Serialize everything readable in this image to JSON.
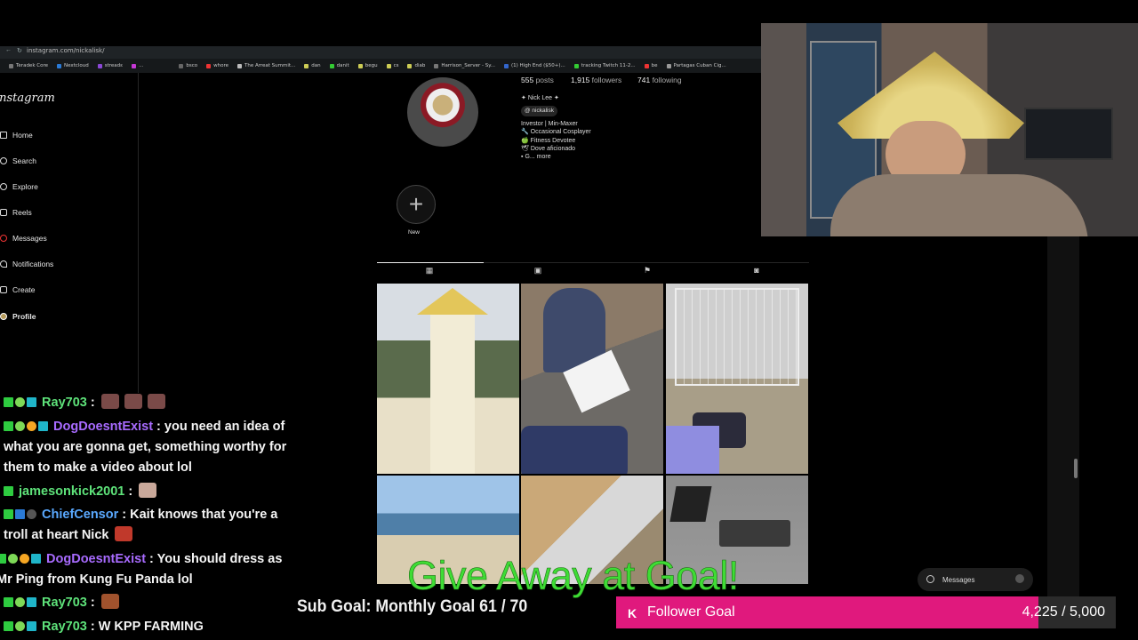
{
  "browser": {
    "url": "instagram.com/nickalisk/",
    "bookmarks": [
      "Teradek Core",
      "Nextcloud",
      "streadε",
      "...",
      "bsco",
      "whore",
      "The Arreat Summit...",
      "dan",
      "danit",
      "begu",
      "cs",
      "diab",
      "Harrison_Server - Sy...",
      "(1) High End ($50+)...",
      "tracking Twitch 11-2...",
      "be",
      "Partagas Cuban Cig..."
    ]
  },
  "instagram": {
    "logo": "Instagram",
    "nav": [
      "Home",
      "Search",
      "Explore",
      "Reels",
      "Messages",
      "Notifications",
      "Create",
      "Profile"
    ],
    "stats": {
      "posts": "555",
      "posts_label": "posts",
      "followers": "1,915",
      "followers_label": "followers",
      "following": "741",
      "following_label": "following"
    },
    "bio": {
      "name": "Nick Lee",
      "handle": "nickalisk",
      "lines": [
        "Investor | Min-Maxer",
        "Occasional Cosplayer",
        "Fitness Devotee",
        "Dove aficionado",
        "G... more"
      ]
    },
    "new_label": "New",
    "new_icon": "+",
    "messages_pill": "Messages"
  },
  "chat": [
    {
      "user": "Ray703",
      "user_color": "#5ee37a",
      "text": ""
    },
    {
      "user": "DogDoesntExist",
      "user_color": "#a86bff",
      "text": "you need an idea of what you are gonna get, something worthy for them to make a video about lol"
    },
    {
      "user": "jamesonkick2001",
      "user_color": "#5ee37a",
      "text": ""
    },
    {
      "user": "ChiefCensor",
      "user_color": "#5aa9ff",
      "text": "Kait knows that you're a troll at heart Nick"
    },
    {
      "user": "DogDoesntExist",
      "user_color": "#a86bff",
      "text": "You should dress as Mr Ping from Kung Fu Panda lol"
    },
    {
      "user": "Ray703",
      "user_color": "#5ee37a",
      "text": ""
    },
    {
      "user": "Ray703",
      "user_color": "#5ee37a",
      "text": "W KPP FARMING"
    }
  ],
  "overlay": {
    "giveaway": "Give Away at Goal!",
    "sub_goal": "Sub Goal: Monthly Goal  61 / 70",
    "follower_goal_label": "Follower Goal",
    "follower_goal_value": "4,225 / 5,000",
    "follower_goal_progress": 0.845,
    "accent": "#e0197d"
  }
}
